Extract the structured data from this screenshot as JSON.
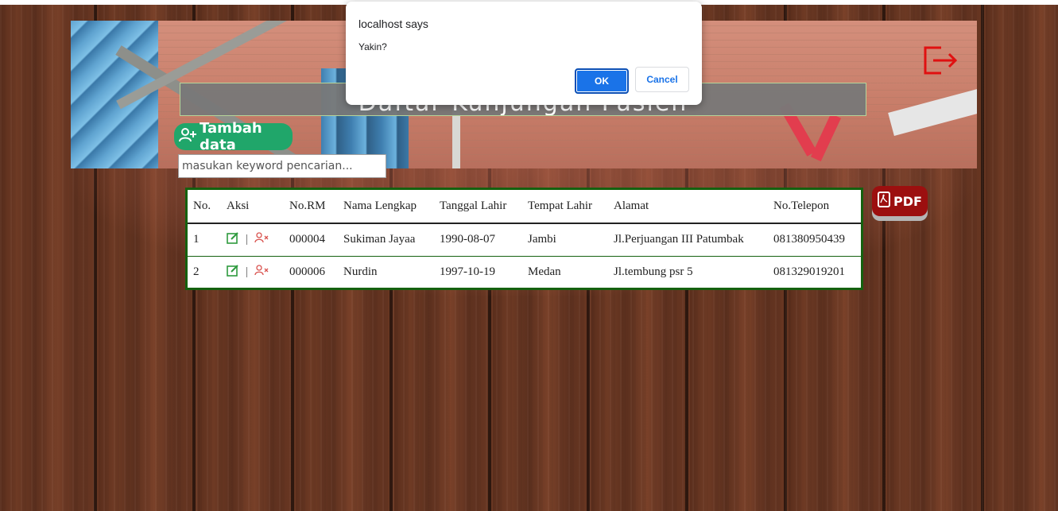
{
  "header": {
    "title": "Daftar Kunjungan Pasien"
  },
  "toolbar": {
    "add_label": "Tambah data",
    "search_placeholder": "masukan keyword pencarian...",
    "pdf_label": "PDF"
  },
  "table": {
    "columns": [
      "No.",
      "Aksi",
      "No.RM",
      "Nama Lengkap",
      "Tanggal Lahir",
      "Tempat Lahir",
      "Alamat",
      "No.Telepon"
    ],
    "rows": [
      {
        "no": "1",
        "rm": "000004",
        "nama": "Sukiman Jayaa",
        "tgl": "1990-08-07",
        "tempat": "Jambi",
        "alamat": "Jl.Perjuangan III Patumbak",
        "telp": "081380950439"
      },
      {
        "no": "2",
        "rm": "000006",
        "nama": "Nurdin",
        "tgl": "1997-10-19",
        "tempat": "Medan",
        "alamat": "Jl.tembung psr 5",
        "telp": "081329019201"
      }
    ],
    "separator": "|"
  },
  "dialog": {
    "title": "localhost says",
    "message": "Yakin?",
    "ok_label": "OK",
    "cancel_label": "Cancel"
  },
  "icons": {
    "logout": "logout-icon",
    "add_user": "add-user-icon",
    "edit": "edit-icon",
    "delete_user": "delete-user-icon",
    "pdf": "pdf-file-icon"
  },
  "colors": {
    "add_button": "#20a66a",
    "pdf_button": "#9c0f0f",
    "table_border": "#15610f",
    "dialog_ok": "#1a73e8",
    "logout_icon": "#e01010"
  }
}
